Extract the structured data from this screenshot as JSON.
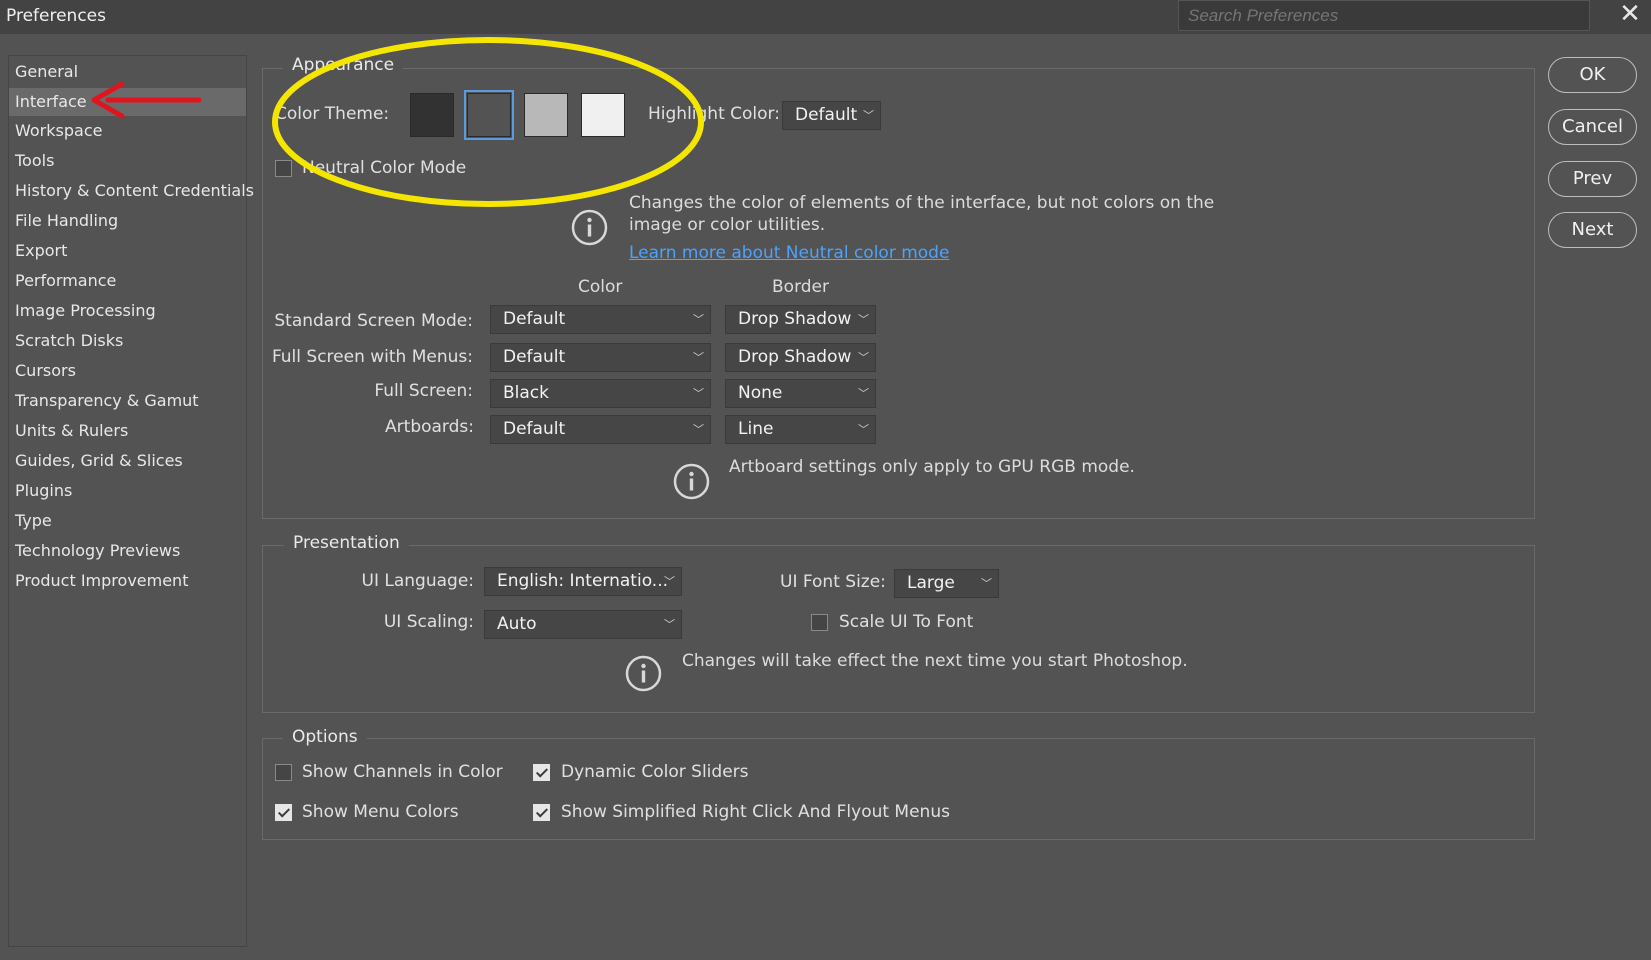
{
  "window": {
    "title": "Preferences",
    "search_placeholder": "Search Preferences",
    "close_glyph": "✕"
  },
  "sidebar": {
    "items": [
      {
        "label": "General"
      },
      {
        "label": "Interface",
        "selected": true
      },
      {
        "label": "Workspace"
      },
      {
        "label": "Tools"
      },
      {
        "label": "History & Content Credentials"
      },
      {
        "label": "File Handling"
      },
      {
        "label": "Export"
      },
      {
        "label": "Performance"
      },
      {
        "label": "Image Processing"
      },
      {
        "label": "Scratch Disks"
      },
      {
        "label": "Cursors"
      },
      {
        "label": "Transparency & Gamut"
      },
      {
        "label": "Units & Rulers"
      },
      {
        "label": "Guides, Grid & Slices"
      },
      {
        "label": "Plugins"
      },
      {
        "label": "Type"
      },
      {
        "label": "Technology Previews"
      },
      {
        "label": "Product Improvement"
      }
    ]
  },
  "appearance": {
    "title": "Appearance",
    "color_theme_label": "Color Theme:",
    "themes": [
      {
        "name": "darkest",
        "color": "#323232",
        "selected": false
      },
      {
        "name": "dark",
        "color": "#535353",
        "selected": true
      },
      {
        "name": "medium-light",
        "color": "#b8b8b8",
        "selected": false
      },
      {
        "name": "lightest",
        "color": "#f0f0f0",
        "selected": false
      }
    ],
    "highlight_color_label": "Highlight Color:",
    "highlight_color_value": "Default",
    "neutral_color_mode_label": "Neutral Color Mode",
    "neutral_color_mode_checked": false,
    "neutral_info_text_line1": "Changes the color of elements of the interface, but not colors on the",
    "neutral_info_text_line2": "image or color utilities.",
    "learn_more_link": "Learn more about Neutral color mode",
    "color_header": "Color",
    "border_header": "Border",
    "rows": [
      {
        "label": "Standard Screen Mode:",
        "color": "Default",
        "border": "Drop Shadow"
      },
      {
        "label": "Full Screen with Menus:",
        "color": "Default",
        "border": "Drop Shadow"
      },
      {
        "label": "Full Screen:",
        "color": "Black",
        "border": "None"
      },
      {
        "label": "Artboards:",
        "color": "Default",
        "border": "Line"
      }
    ],
    "artboard_info": "Artboard settings only apply to GPU RGB mode."
  },
  "presentation": {
    "title": "Presentation",
    "ui_language_label": "UI Language:",
    "ui_language_value": "English: Internatio...",
    "ui_font_size_label": "UI Font Size:",
    "ui_font_size_value": "Large",
    "ui_scaling_label": "UI Scaling:",
    "ui_scaling_value": "Auto",
    "scale_ui_to_font_label": "Scale UI To Font",
    "scale_ui_to_font_checked": false,
    "restart_info": "Changes will take effect the next time you start Photoshop."
  },
  "options": {
    "title": "Options",
    "show_channels_in_color": {
      "label": "Show Channels in Color",
      "checked": false
    },
    "dynamic_color_sliders": {
      "label": "Dynamic Color Sliders",
      "checked": true
    },
    "show_menu_colors": {
      "label": "Show Menu Colors",
      "checked": true
    },
    "show_simplified_menus": {
      "label": "Show Simplified Right Click And Flyout Menus",
      "checked": true
    }
  },
  "buttons": {
    "ok": "OK",
    "cancel": "Cancel",
    "prev": "Prev",
    "next": "Next"
  },
  "colors": {
    "annotation_circle": "#f5e600",
    "annotation_arrow": "#e0141e",
    "link": "#4aa3ff",
    "selection_outline": "#5a9be0"
  }
}
